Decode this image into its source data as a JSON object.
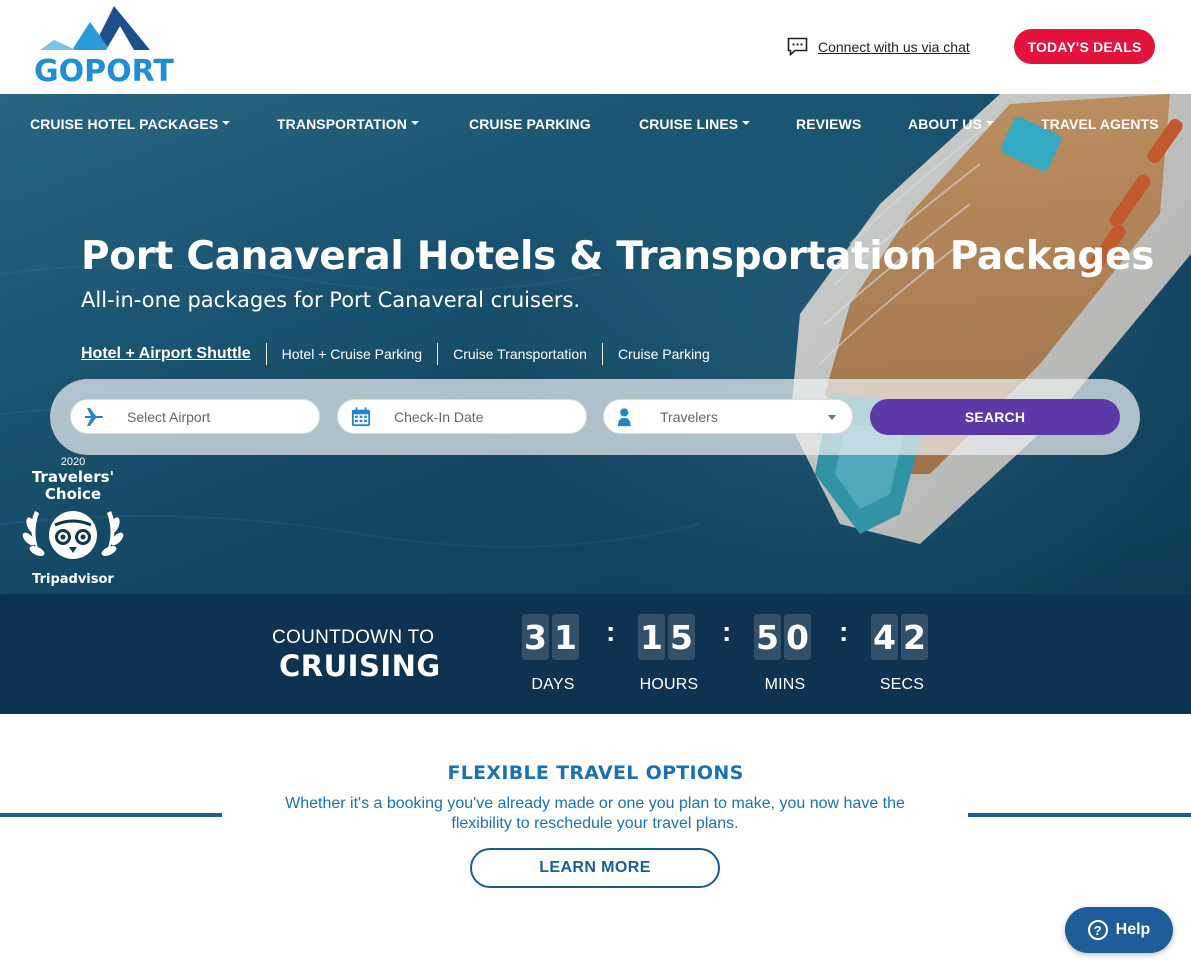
{
  "header": {
    "logo_text": "GOPORT",
    "chat_label": "Connect with us via chat",
    "deals_label": "TODAY'S DEALS"
  },
  "nav": {
    "items": [
      {
        "label": "CRUISE HOTEL PACKAGES"
      },
      {
        "label": "TRANSPORTATION"
      },
      {
        "label": "CRUISE PARKING"
      },
      {
        "label": "CRUISE LINES"
      },
      {
        "label": "REVIEWS"
      },
      {
        "label": "ABOUT US"
      },
      {
        "label": "TRAVEL AGENTS"
      }
    ]
  },
  "hero": {
    "title": "Port Canaveral Hotels & Transportation Packages",
    "subtitle": "All-in-one packages for Port Canaveral cruisers.",
    "tabs": [
      {
        "label": "Hotel + Airport Shuttle"
      },
      {
        "label": "Hotel + Cruise Parking"
      },
      {
        "label": "Cruise Transportation"
      },
      {
        "label": "Cruise Parking"
      }
    ]
  },
  "search": {
    "airport_placeholder": "Select Airport",
    "checkin_placeholder": "Check-In Date",
    "travelers_label": "Travelers",
    "search_label": "SEARCH"
  },
  "badge": {
    "year": "2020",
    "title_line1": "Travelers'",
    "title_line2": "Choice",
    "brand": "Tripadvisor"
  },
  "countdown": {
    "title_small": "COUNTDOWN TO",
    "title_big": "CRUISING",
    "days": [
      "3",
      "1"
    ],
    "hours": [
      "1",
      "5"
    ],
    "mins": [
      "5",
      "0"
    ],
    "secs": [
      "4",
      "2"
    ],
    "separator": ":",
    "units": [
      "DAYS",
      "HOURS",
      "MINS",
      "SECS"
    ]
  },
  "flex": {
    "title": "FLEXIBLE TRAVEL OPTIONS",
    "text": "Whether it's a booking you've already made or one you plan to make, you now have the flexibility to reschedule your travel plans.",
    "button_label": "LEARN MORE"
  },
  "help": {
    "label": "Help",
    "icon_glyph": "?"
  },
  "colors": {
    "brand_blue": "#1e8fd6",
    "deals_red": "#e3133e",
    "search_purple": "#5b3aa8",
    "countdown_navy": "#0e3252"
  }
}
